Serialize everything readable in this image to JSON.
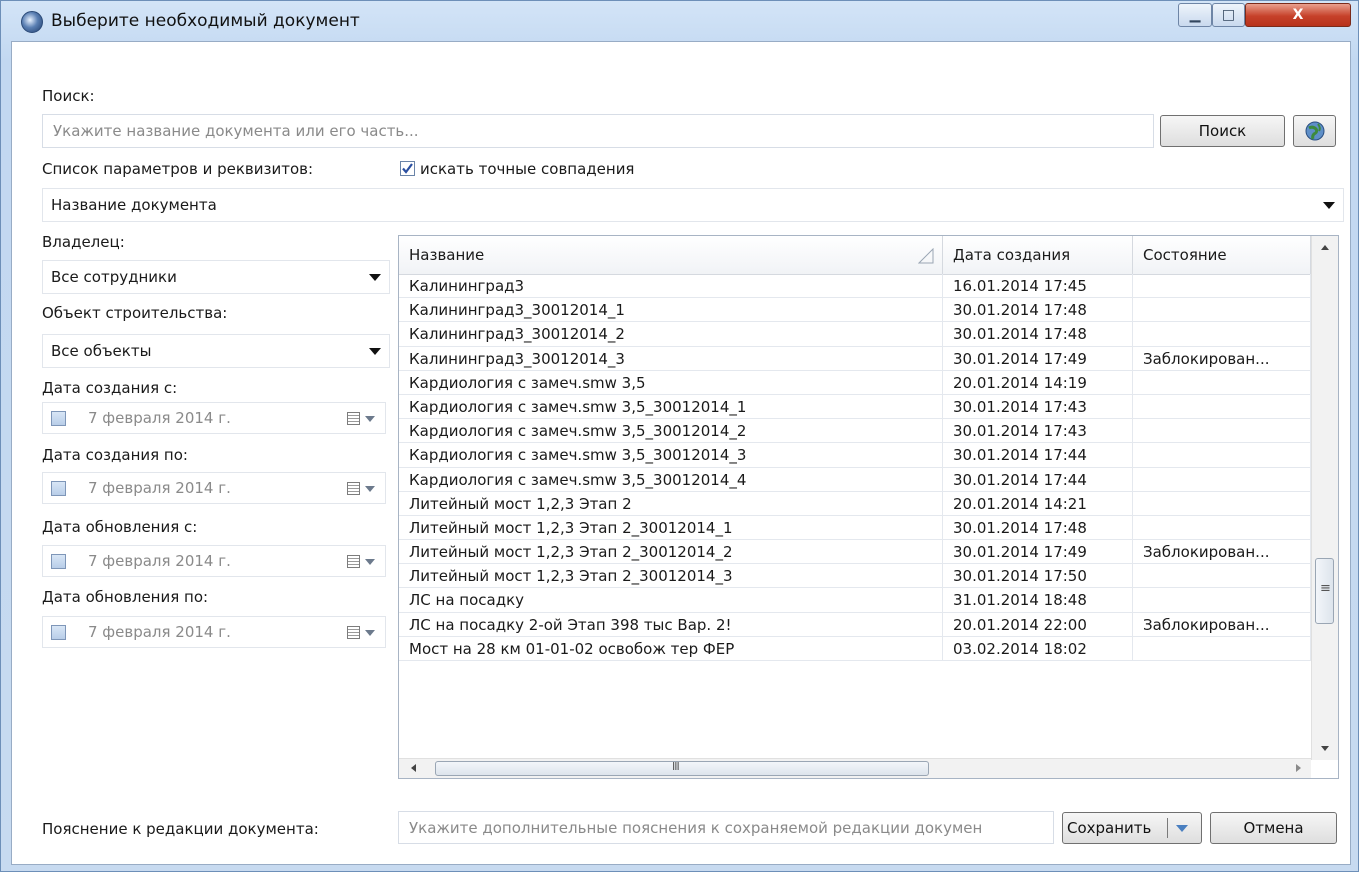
{
  "window": {
    "title": "Выберите необходимый документ",
    "controls": {
      "minimize": "▁",
      "maximize": "□",
      "close": "X"
    }
  },
  "search": {
    "label": "Поиск:",
    "placeholder": "Укажите название документа или его часть...",
    "button": "Поиск"
  },
  "params": {
    "label": "Список параметров и реквизитов:",
    "exact_match_label": "искать точные совпадения",
    "exact_match_checked": true,
    "selected": "Название документа"
  },
  "filters": {
    "owner_label": "Владелец:",
    "owner_value": "Все сотрудники",
    "object_label": "Объект строительства:",
    "object_value": "Все объекты",
    "created_from_label": "Дата создания с:",
    "created_from_value": "7 февраля  2014 г.",
    "created_to_label": "Дата создания по:",
    "created_to_value": "7 февраля  2014 г.",
    "updated_from_label": "Дата обновления с:",
    "updated_from_value": "7 февраля  2014 г.",
    "updated_to_label": "Дата обновления по:",
    "updated_to_value": "7 февраля  2014 г."
  },
  "table": {
    "columns": [
      "Название",
      "Дата создания",
      "Состояние"
    ],
    "rows": [
      [
        "Калининград3",
        "16.01.2014 17:45",
        ""
      ],
      [
        "Калининград3_30012014_1",
        "30.01.2014 17:48",
        ""
      ],
      [
        "Калининград3_30012014_2",
        "30.01.2014 17:48",
        ""
      ],
      [
        "Калининград3_30012014_3",
        "30.01.2014 17:49",
        "Заблокирован..."
      ],
      [
        "Кардиология с замеч.smw 3,5",
        "20.01.2014 14:19",
        ""
      ],
      [
        "Кардиология с замеч.smw 3,5_30012014_1",
        "30.01.2014 17:43",
        ""
      ],
      [
        "Кардиология с замеч.smw 3,5_30012014_2",
        "30.01.2014 17:43",
        ""
      ],
      [
        "Кардиология с замеч.smw 3,5_30012014_3",
        "30.01.2014 17:44",
        ""
      ],
      [
        "Кардиология с замеч.smw 3,5_30012014_4",
        "30.01.2014 17:44",
        ""
      ],
      [
        "Литейный мост 1,2,3  Этап   2",
        "20.01.2014 14:21",
        ""
      ],
      [
        "Литейный мост 1,2,3  Этап   2_30012014_1",
        "30.01.2014 17:48",
        ""
      ],
      [
        "Литейный мост 1,2,3  Этап   2_30012014_2",
        "30.01.2014 17:49",
        "Заблокирован..."
      ],
      [
        "Литейный мост 1,2,3  Этап   2_30012014_3",
        "30.01.2014 17:50",
        ""
      ],
      [
        "ЛС на посадку",
        "31.01.2014 18:48",
        ""
      ],
      [
        "ЛС на посадку  2-ой Этап 398 тыс  Вар. 2!",
        "20.01.2014 22:00",
        "Заблокирован..."
      ],
      [
        "Мост на 28 км 01-01-02 освобож тер ФЕР",
        "03.02.2014 18:02",
        ""
      ]
    ],
    "hscroll_grip": "III",
    "vscroll_grip": "≡"
  },
  "footer": {
    "note_label": "Пояснение к редакции документа:",
    "note_placeholder": "Укажите дополнительные пояснения к сохраняемой редакции докумен",
    "save_label": "Сохранить",
    "cancel_label": "Отмена"
  }
}
